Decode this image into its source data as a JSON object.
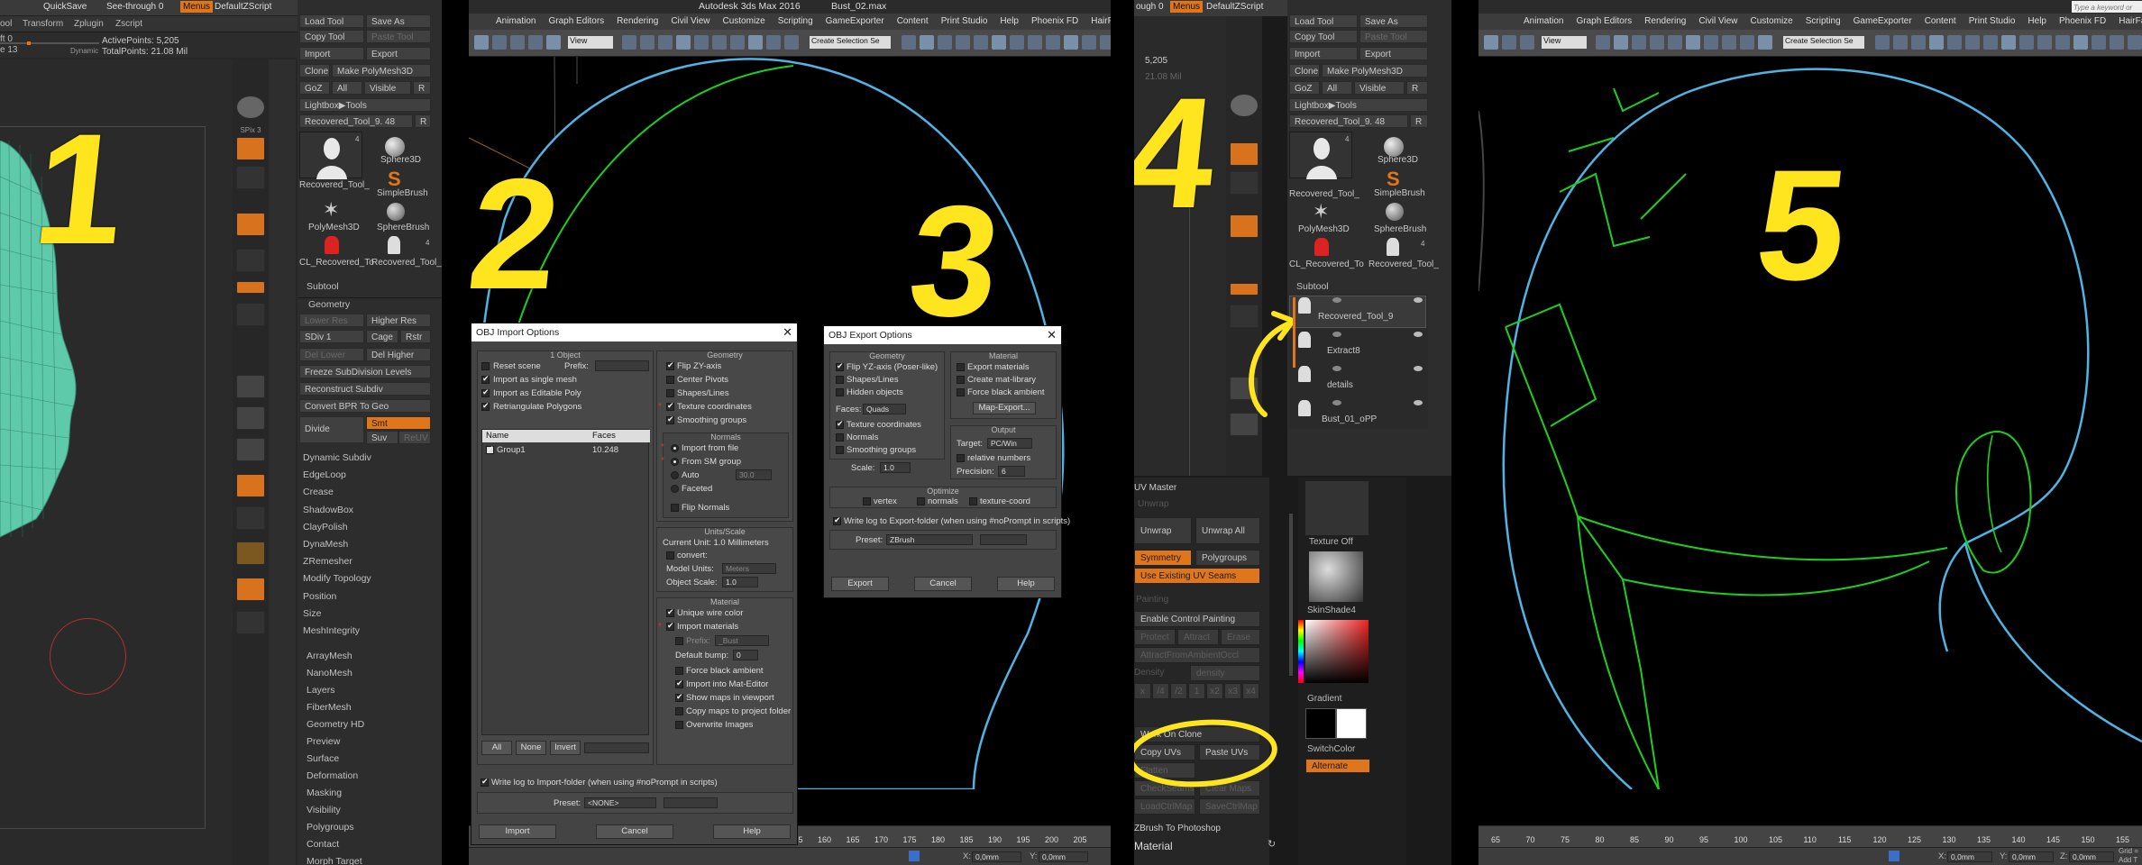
{
  "panel1": {
    "top": {
      "quicksave": "QuickSave",
      "seethrough": "See-through",
      "seethrough_val": "0",
      "menus": "Menus",
      "script": "DefaultZScript"
    },
    "menu": [
      "ool",
      "Transform",
      "Zplugin",
      "Zscript"
    ],
    "left": {
      "t1": "ft 0",
      "t2": "e 13",
      "dynamic": "Dynamic"
    },
    "active_points": "ActivePoints: 5,205",
    "total_points": "TotalPoints: 21.08 Mil",
    "tools": {
      "load": "Load Tool",
      "save_as": "Save As",
      "copy": "Copy Tool",
      "paste": "Paste Tool",
      "import": "Import",
      "export": "Export",
      "clone": "Clone",
      "make_poly": "Make PolyMesh3D",
      "goz": "GoZ",
      "all": "All",
      "visible": "Visible",
      "r": "R",
      "lightbox": "Lightbox▶Tools",
      "recovered": "Recovered_Tool_9. 48",
      "r2": "R"
    },
    "thumbs": [
      {
        "label": "Recovered_Tool_",
        "count": "4"
      },
      {
        "label": "Sphere3D",
        "count": ""
      },
      {
        "label": "SimpleBrush",
        "count": ""
      },
      {
        "label": "PolyMesh3D",
        "count": ""
      },
      {
        "label": "SphereBrush",
        "count": ""
      },
      {
        "label": "CL_Recovered_To",
        "count": ""
      },
      {
        "label": "Recovered_Tool_",
        "count": "4"
      }
    ],
    "side_tools": [
      {
        "label": "BPR",
        "hl": false
      },
      {
        "label": "SPix 3",
        "hl": false
      },
      {
        "label": "Persp",
        "hl": true
      },
      {
        "label": "Floor",
        "hl": false
      },
      {
        "label": "Local",
        "hl": true
      },
      {
        "label": "L.Sym",
        "hl": false
      },
      {
        "label": "Qxyz",
        "hl": true
      },
      {
        "label": "Frame",
        "hl": false
      },
      {
        "label": "Move",
        "hl": false
      },
      {
        "label": "Zoom3D",
        "hl": false
      },
      {
        "label": "Rotate",
        "hl": false
      },
      {
        "label": "PolyF",
        "hl": true
      },
      {
        "label": "Transp",
        "hl": false
      },
      {
        "label": "Ghost",
        "hl": true
      },
      {
        "label": "Solo",
        "hl": true
      },
      {
        "label": "Xpose",
        "hl": false
      }
    ],
    "subtool": "Subtool",
    "geometry": "Geometry",
    "geo": {
      "lower": "Lower Res",
      "higher": "Higher Res",
      "sdiv": "SDiv 1",
      "cage": "Cage",
      "rstr": "Rstr",
      "del_lower": "Del Lower",
      "del_higher": "Del Higher",
      "freeze": "Freeze SubDivision Levels",
      "reconstruct": "Reconstruct Subdiv",
      "convert": "Convert BPR To Geo",
      "divide": "Divide",
      "smt": "Smt",
      "suv": "Suv",
      "reuv": "ReUV"
    },
    "items": [
      "Dynamic Subdiv",
      "EdgeLoop",
      "Crease",
      "ShadowBox",
      "ClayPolish",
      "DynaMesh",
      "ZRemesher",
      "Modify Topology",
      "Position",
      "Size",
      "MeshIntegrity"
    ],
    "items2": [
      "ArrayMesh",
      "NanoMesh",
      "Layers",
      "FiberMesh",
      "Geometry HD",
      "Preview",
      "Surface",
      "Deformation",
      "Masking",
      "Visibility",
      "Polygroups",
      "Contact",
      "Morph Target"
    ]
  },
  "max": {
    "title": "Autodesk 3ds Max 2016",
    "file": "Bust_02.max",
    "menu": [
      "Animation",
      "Graph Editors",
      "Rendering",
      "Civil View",
      "Customize",
      "Scripting",
      "GameExporter",
      "Content",
      "Print Studio",
      "Help",
      "Phoenix FD",
      "HairFarm"
    ],
    "view": "View",
    "selset": "Create Selection Se",
    "timeline": [
      "110",
      "115",
      "120",
      "125",
      "130",
      "135",
      "140",
      "145",
      "150",
      "155",
      "160",
      "165",
      "170",
      "175",
      "180",
      "185",
      "190",
      "195",
      "200",
      "205"
    ],
    "status": {
      "x": "X:",
      "xv": "0,0mm",
      "y": "Y:",
      "yv": "0,0mm",
      "z": "Z:",
      "zv": "0,0mm",
      "grid": "Grid =",
      "add": "Add T"
    },
    "timeline2": [
      "65",
      "70",
      "75",
      "80",
      "85",
      "90",
      "95",
      "100",
      "105",
      "110",
      "115",
      "120",
      "125",
      "130",
      "135",
      "140",
      "145",
      "150",
      "155"
    ],
    "search": "Type a keyword or"
  },
  "import_dlg": {
    "title": "OBJ Import Options",
    "object_grp": "1 Object",
    "reset": "Reset scene",
    "prefix": "Prefix:",
    "single": "Import as single mesh",
    "editable": "Import as Editable Poly",
    "retri": "Retriangulate Polygons",
    "col_name": "Name",
    "col_faces": "Faces",
    "row_name": "Group1",
    "row_faces": "10.248",
    "btn_all": "All",
    "btn_none": "None",
    "btn_invert": "Invert",
    "geometry": "Geometry",
    "flip": "Flip ZY-axis",
    "pivots": "Center Pivots",
    "shapes": "Shapes/Lines",
    "texcoords": "Texture coordinates",
    "smooth": "Smoothing groups",
    "normals_grp": "Normals",
    "from_file": "Import from file",
    "from_sm": "From SM group",
    "auto": "Auto",
    "auto_v": "30.0",
    "faceted": "Faceted",
    "flip_normals": "Flip Normals",
    "units_grp": "Units/Scale",
    "current_unit": "Current Unit:  1.0 Millimeters",
    "convert": "convert:",
    "model_units": "Model Units:",
    "model_v": "Meters",
    "obj_scale": "Object Scale:",
    "obj_scale_v": "1.0",
    "material_grp": "Material",
    "unique_wire": "Unique wire color",
    "import_mat": "Import materials",
    "prefix2": "Prefix:",
    "prefix2_v": "_Bust",
    "bump": "Default bump:",
    "bump_v": "0",
    "force_black": "Force black ambient",
    "into_mat": "Import into Mat-Editor",
    "show_maps": "Show maps in viewport",
    "copy_maps": "Copy maps to project folder",
    "overwrite": "Overwrite Images",
    "write_log": "Write log to Import-folder (when using #noPrompt in scripts)",
    "preset": "Preset:",
    "preset_v": "<NONE>",
    "btn_import": "Import",
    "btn_cancel": "Cancel",
    "btn_help": "Help"
  },
  "export_dlg": {
    "title": "OBJ Export Options",
    "geometry": "Geometry",
    "flip": "Flip YZ-axis (Poser-like)",
    "shapes": "Shapes/Lines",
    "hidden": "Hidden objects",
    "faces": "Faces:",
    "faces_v": "Quads",
    "texcoords": "Texture coordinates",
    "normals": "Normals",
    "smooth": "Smoothing groups",
    "scale": "Scale:",
    "scale_v": "1.0",
    "material": "Material",
    "export_mat": "Export materials",
    "create_lib": "Create mat-library",
    "force_black": "Force black ambient",
    "map_export": "Map-Export...",
    "output": "Output",
    "target": "Target:",
    "target_v": "PC/Win",
    "relative": "relative numbers",
    "precision": "Precision:",
    "precision_v": "6",
    "optimize": "Optimize",
    "vertex": "vertex",
    "normals2": "normals",
    "texture_coord": "texture-coord",
    "write_log": "Write log to Export-folder (when using #noPrompt in scripts)",
    "preset": "Preset:",
    "preset_v": "ZBrush",
    "btn_export": "Export",
    "btn_cancel": "Cancel",
    "btn_help": "Help"
  },
  "panel4": {
    "top": {
      "seethrough": "ough",
      "val": "0",
      "menus": "Menus",
      "script": "DefaultZScript"
    },
    "active": "5,205",
    "total": "21.08 Mil",
    "subtool": "Subtool",
    "subtools": [
      {
        "name": "Recovered_Tool_9"
      },
      {
        "name": "Extract8"
      },
      {
        "name": "details"
      },
      {
        "name": "Bust_01_oPP"
      }
    ]
  },
  "uv": {
    "title": "UV Master",
    "unwrap_hdr": "Unwrap",
    "unwrap": "Unwrap",
    "unwrap_all": "Unwrap All",
    "symmetry": "Symmetry",
    "polygroups": "Polygroups",
    "existing": "Use Existing UV Seams",
    "painting": "Painting",
    "enable_cp": "Enable Control Painting",
    "protect": "Protect",
    "attract": "Attract",
    "erase": "Erase",
    "ambient": "AttractFromAmbientOccl",
    "density": "Density",
    "density2": "density",
    "d_vals": [
      "x",
      "/4",
      "/2",
      "1",
      "x2",
      "x3",
      "x4"
    ],
    "work_clone": "Work On Clone",
    "copy_uvs": "Copy UVs",
    "paste_uvs": "Paste UVs",
    "flatten": "Flatten",
    "check_seams": "CheckSeams",
    "clear_maps": "Clear Maps",
    "load_ctrl": "LoadCtrlMap",
    "save_ctrl": "SaveCtrlMap",
    "zb_ps": "ZBrush To Photoshop",
    "material": "Material",
    "texture_off": "Texture Off",
    "skinshade": "SkinShade4",
    "gradient": "Gradient",
    "switch_color": "SwitchColor",
    "alternate": "Alternate"
  },
  "numbers": [
    "1",
    "2",
    "3",
    "4",
    "5"
  ],
  "colors": {
    "orange": "#e0761b",
    "yellow": "#ffe51e",
    "wire_green": "#1bd11b",
    "outline_blue": "#4fb4e4",
    "mesh_teal": "#5ecaa9"
  }
}
